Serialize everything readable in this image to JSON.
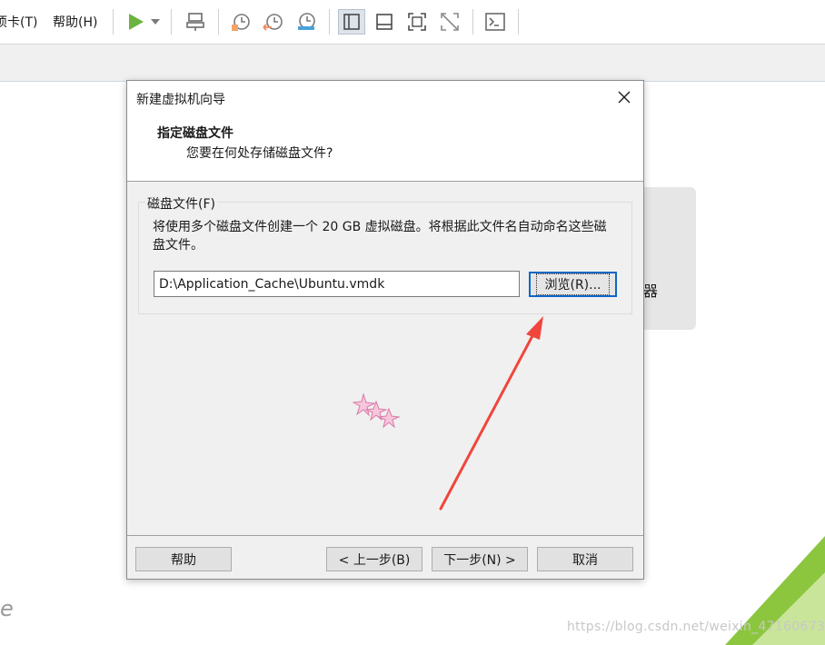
{
  "menu": {
    "tabs_label": "项卡(T)",
    "help_label": "帮助(H)"
  },
  "background": {
    "card_text": "器",
    "logo_fragment": "e",
    "watermark": "https://blog.csdn.net/weixin_47160673"
  },
  "dialog": {
    "title": "新建虚拟机向导",
    "header_title": "指定磁盘文件",
    "header_subtitle": "您要在何处存储磁盘文件?",
    "group_legend": "磁盘文件(F)",
    "group_description": "将使用多个磁盘文件创建一个 20 GB 虚拟磁盘。将根据此文件名自动命名这些磁盘文件。",
    "path_value": "D:\\Application_Cache\\Ubuntu.vmdk",
    "browse_label": "浏览(R)...",
    "buttons": {
      "help": "帮助",
      "back": "< 上一步(B)",
      "next": "下一步(N) >",
      "cancel": "取消"
    }
  },
  "colors": {
    "annotation_arrow": "#f0463c",
    "accent_play": "#6cb33f",
    "focus_border": "#0c66c8"
  }
}
